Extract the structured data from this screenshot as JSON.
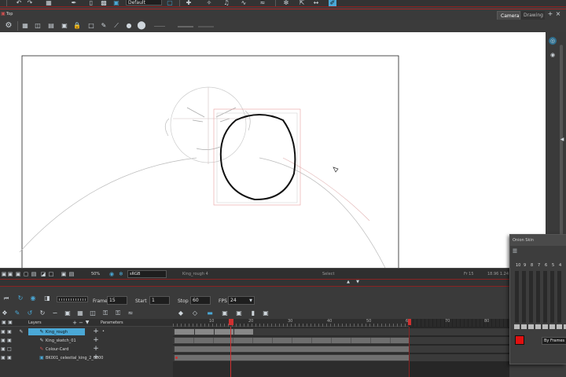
{
  "top_toolbar": {
    "preset_select": "Default"
  },
  "view_panel": {
    "title": "Top",
    "tabs": [
      {
        "label": "Camera",
        "active": true
      },
      {
        "label": "Drawing",
        "active": false
      }
    ]
  },
  "status_bar": {
    "zoom": "50%",
    "color_space": "sRGB",
    "layer": "King_rough 4",
    "tool": "Select",
    "frame": "Fr 15",
    "coords": "18.96 1.24"
  },
  "playback": {
    "frame_label": "Frame",
    "frame_value": "15",
    "start_label": "Start",
    "start_value": "1",
    "stop_label": "Stop",
    "stop_value": "60",
    "fps_label": "FPS",
    "fps_value": "24"
  },
  "timeline": {
    "layers_header": "Layers",
    "params_header": "Parameters",
    "layers": [
      {
        "name": "King_rough",
        "selected": true
      },
      {
        "name": "King_sketch_01",
        "selected": false
      },
      {
        "name": "Colour-Card",
        "selected": false
      },
      {
        "name": "BK001_celestial_king_2_0000",
        "selected": false
      }
    ],
    "ruler_labels": [
      "10",
      "20",
      "30",
      "40",
      "50",
      "60",
      "70",
      "80"
    ],
    "current_frame": 15,
    "scene_end_frame": 60
  },
  "onion_skin": {
    "title": "Onion Skin",
    "numbers": [
      "10",
      "9",
      "8",
      "7",
      "6",
      "5",
      "4"
    ],
    "by_frames": "By Frames",
    "color": "#e01010"
  },
  "colors": {
    "accent": "#4aa8d6",
    "playhead": "#d03030",
    "red_outline": "#a02828"
  }
}
